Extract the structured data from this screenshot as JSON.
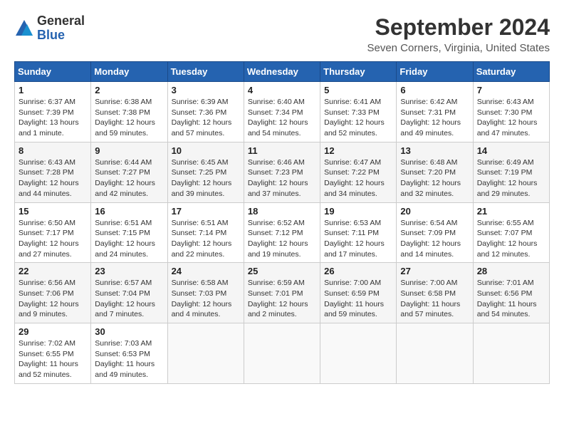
{
  "header": {
    "logo_general": "General",
    "logo_blue": "Blue",
    "title": "September 2024",
    "subtitle": "Seven Corners, Virginia, United States"
  },
  "columns": [
    "Sunday",
    "Monday",
    "Tuesday",
    "Wednesday",
    "Thursday",
    "Friday",
    "Saturday"
  ],
  "weeks": [
    [
      {
        "day": "1",
        "info": "Sunrise: 6:37 AM\nSunset: 7:39 PM\nDaylight: 13 hours\nand 1 minute."
      },
      {
        "day": "2",
        "info": "Sunrise: 6:38 AM\nSunset: 7:38 PM\nDaylight: 12 hours\nand 59 minutes."
      },
      {
        "day": "3",
        "info": "Sunrise: 6:39 AM\nSunset: 7:36 PM\nDaylight: 12 hours\nand 57 minutes."
      },
      {
        "day": "4",
        "info": "Sunrise: 6:40 AM\nSunset: 7:34 PM\nDaylight: 12 hours\nand 54 minutes."
      },
      {
        "day": "5",
        "info": "Sunrise: 6:41 AM\nSunset: 7:33 PM\nDaylight: 12 hours\nand 52 minutes."
      },
      {
        "day": "6",
        "info": "Sunrise: 6:42 AM\nSunset: 7:31 PM\nDaylight: 12 hours\nand 49 minutes."
      },
      {
        "day": "7",
        "info": "Sunrise: 6:43 AM\nSunset: 7:30 PM\nDaylight: 12 hours\nand 47 minutes."
      }
    ],
    [
      {
        "day": "8",
        "info": "Sunrise: 6:43 AM\nSunset: 7:28 PM\nDaylight: 12 hours\nand 44 minutes."
      },
      {
        "day": "9",
        "info": "Sunrise: 6:44 AM\nSunset: 7:27 PM\nDaylight: 12 hours\nand 42 minutes."
      },
      {
        "day": "10",
        "info": "Sunrise: 6:45 AM\nSunset: 7:25 PM\nDaylight: 12 hours\nand 39 minutes."
      },
      {
        "day": "11",
        "info": "Sunrise: 6:46 AM\nSunset: 7:23 PM\nDaylight: 12 hours\nand 37 minutes."
      },
      {
        "day": "12",
        "info": "Sunrise: 6:47 AM\nSunset: 7:22 PM\nDaylight: 12 hours\nand 34 minutes."
      },
      {
        "day": "13",
        "info": "Sunrise: 6:48 AM\nSunset: 7:20 PM\nDaylight: 12 hours\nand 32 minutes."
      },
      {
        "day": "14",
        "info": "Sunrise: 6:49 AM\nSunset: 7:19 PM\nDaylight: 12 hours\nand 29 minutes."
      }
    ],
    [
      {
        "day": "15",
        "info": "Sunrise: 6:50 AM\nSunset: 7:17 PM\nDaylight: 12 hours\nand 27 minutes."
      },
      {
        "day": "16",
        "info": "Sunrise: 6:51 AM\nSunset: 7:15 PM\nDaylight: 12 hours\nand 24 minutes."
      },
      {
        "day": "17",
        "info": "Sunrise: 6:51 AM\nSunset: 7:14 PM\nDaylight: 12 hours\nand 22 minutes."
      },
      {
        "day": "18",
        "info": "Sunrise: 6:52 AM\nSunset: 7:12 PM\nDaylight: 12 hours\nand 19 minutes."
      },
      {
        "day": "19",
        "info": "Sunrise: 6:53 AM\nSunset: 7:11 PM\nDaylight: 12 hours\nand 17 minutes."
      },
      {
        "day": "20",
        "info": "Sunrise: 6:54 AM\nSunset: 7:09 PM\nDaylight: 12 hours\nand 14 minutes."
      },
      {
        "day": "21",
        "info": "Sunrise: 6:55 AM\nSunset: 7:07 PM\nDaylight: 12 hours\nand 12 minutes."
      }
    ],
    [
      {
        "day": "22",
        "info": "Sunrise: 6:56 AM\nSunset: 7:06 PM\nDaylight: 12 hours\nand 9 minutes."
      },
      {
        "day": "23",
        "info": "Sunrise: 6:57 AM\nSunset: 7:04 PM\nDaylight: 12 hours\nand 7 minutes."
      },
      {
        "day": "24",
        "info": "Sunrise: 6:58 AM\nSunset: 7:03 PM\nDaylight: 12 hours\nand 4 minutes."
      },
      {
        "day": "25",
        "info": "Sunrise: 6:59 AM\nSunset: 7:01 PM\nDaylight: 12 hours\nand 2 minutes."
      },
      {
        "day": "26",
        "info": "Sunrise: 7:00 AM\nSunset: 6:59 PM\nDaylight: 11 hours\nand 59 minutes."
      },
      {
        "day": "27",
        "info": "Sunrise: 7:00 AM\nSunset: 6:58 PM\nDaylight: 11 hours\nand 57 minutes."
      },
      {
        "day": "28",
        "info": "Sunrise: 7:01 AM\nSunset: 6:56 PM\nDaylight: 11 hours\nand 54 minutes."
      }
    ],
    [
      {
        "day": "29",
        "info": "Sunrise: 7:02 AM\nSunset: 6:55 PM\nDaylight: 11 hours\nand 52 minutes."
      },
      {
        "day": "30",
        "info": "Sunrise: 7:03 AM\nSunset: 6:53 PM\nDaylight: 11 hours\nand 49 minutes."
      },
      null,
      null,
      null,
      null,
      null
    ]
  ]
}
